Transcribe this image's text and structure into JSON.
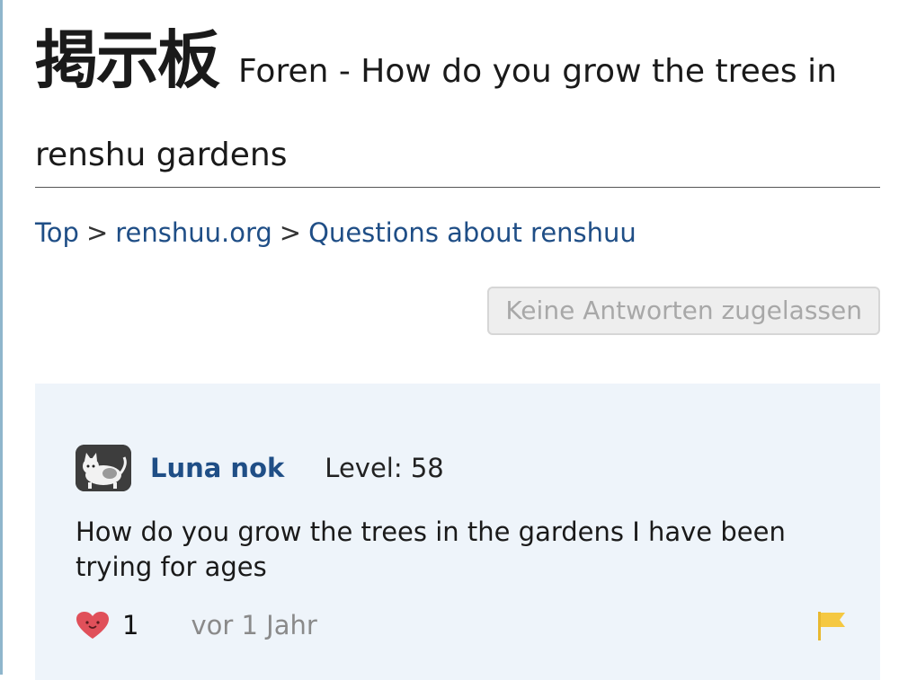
{
  "header": {
    "kanji_title": "掲示板",
    "thread_title_line1": "Foren - How do you grow the trees in",
    "thread_title_line2": "renshu gardens"
  },
  "breadcrumb": {
    "items": [
      "Top",
      "renshuu.org",
      "Questions about renshuu"
    ],
    "separator": ">"
  },
  "actions": {
    "reply_button_label": "Keine Antworten zugelassen"
  },
  "post": {
    "author": "Luna nok",
    "level_label": "Level: 58",
    "body": "How do you grow the trees in the gardens I have been trying for ages",
    "like_count": "1",
    "timestamp": "vor 1 Jahr",
    "icons": {
      "avatar": "cat-avatar",
      "like": "heart-icon",
      "report": "flag-icon"
    }
  },
  "colors": {
    "link": "#1f4e86",
    "card_bg": "#eef4fa",
    "heart": "#e0505a",
    "flag": "#f5c842"
  }
}
